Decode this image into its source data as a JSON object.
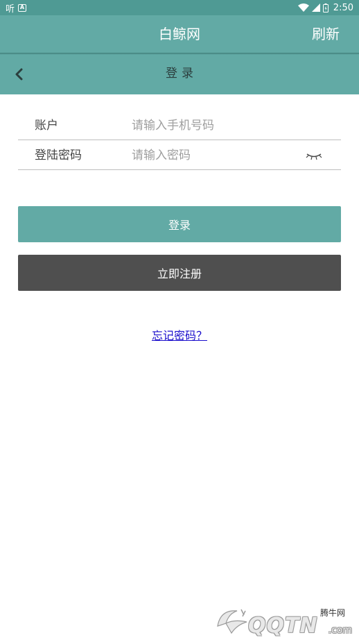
{
  "status_bar": {
    "app_indicator": "听",
    "notification_icon": "a-icon",
    "time": "2:50"
  },
  "app_bar": {
    "title": "白鲸网",
    "refresh_label": "刷新"
  },
  "page_header": {
    "title": "登录",
    "back_icon": "chevron-left-icon"
  },
  "form": {
    "account_label": "账户",
    "account_placeholder": "请输入手机号码",
    "password_label": "登陆密码",
    "password_placeholder": "请输入密码",
    "eye_icon": "eye-closed-icon"
  },
  "buttons": {
    "login_label": "登录",
    "register_label": "立即注册"
  },
  "links": {
    "forgot_password": "忘记密码？"
  },
  "watermark": {
    "small_text": "腾牛网",
    "main_text": "QQTN",
    "suffix": ".com"
  },
  "colors": {
    "primary": "#62aaa5",
    "status_bar": "#4f9a94",
    "register_button": "#4f4f4f",
    "link": "#1a0dcc"
  }
}
